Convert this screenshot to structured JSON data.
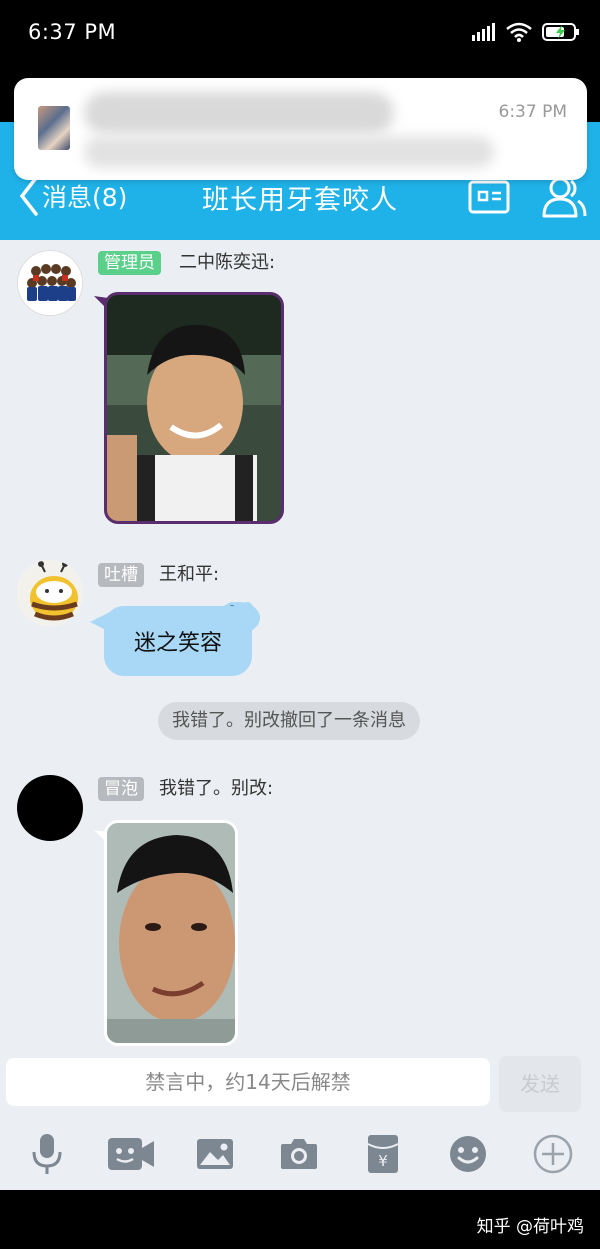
{
  "status_bar": {
    "time": "6:37 PM",
    "icons": [
      "signal-icon",
      "wifi-icon",
      "battery-charging-icon"
    ]
  },
  "notification": {
    "time": "6:37 PM"
  },
  "header": {
    "back_label": "消息(8)",
    "title": "班长用牙套咬人",
    "right_icons": [
      "profile-card-icon",
      "group-members-icon"
    ],
    "color": "#1fb2e8"
  },
  "messages": [
    {
      "tag": "管理员",
      "tag_color": "#5bd08a",
      "sender": "二中陈奕迅:",
      "type": "image"
    },
    {
      "tag": "吐槽",
      "tag_color": "#b6b9bd",
      "sender": "王和平:",
      "type": "text",
      "text": "迷之笑容"
    },
    {
      "tag": "冒泡",
      "tag_color": "#b6b9bd",
      "sender": "我错了。别改:",
      "type": "image"
    }
  ],
  "system_notice": "我错了。别改撤回了一条消息",
  "input": {
    "placeholder": "禁言中，约14天后解禁",
    "send_label": "发送"
  },
  "toolbar": [
    "mic-icon",
    "video-icon",
    "image-icon",
    "camera-icon",
    "red-packet-icon",
    "emoji-icon",
    "add-icon"
  ],
  "watermark": "知乎 @荷叶鸡"
}
